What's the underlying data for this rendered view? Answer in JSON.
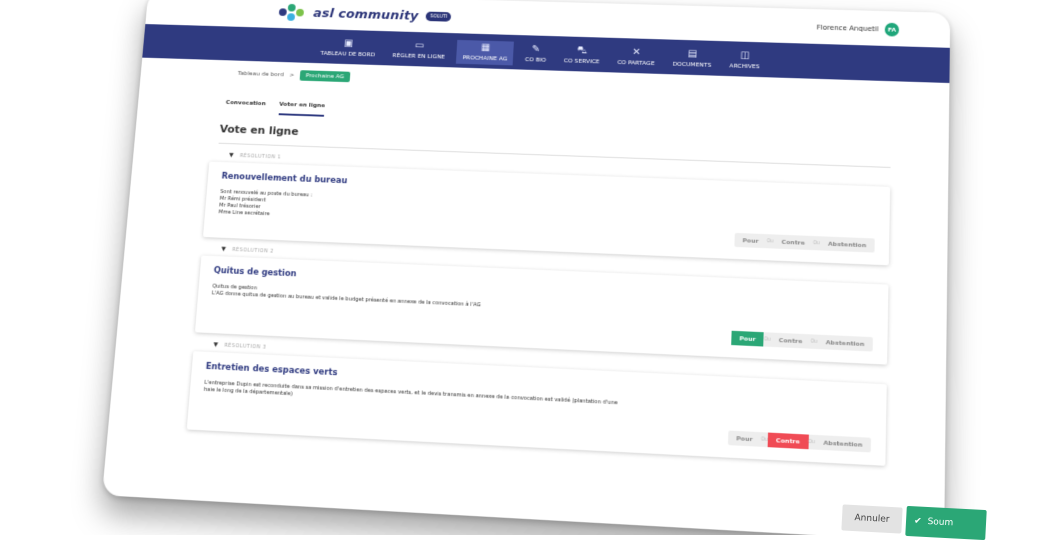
{
  "header": {
    "app_name": "asl community",
    "badge": "SOLUTI",
    "user_name": "Florence Anquetil",
    "user_initials": "FA"
  },
  "nav": [
    {
      "label": "TABLEAU DE BORD",
      "icon": "dashboard-icon"
    },
    {
      "label": "RÉGLER EN LIGNE",
      "icon": "credit-card-icon"
    },
    {
      "label": "PROCHAINE AG",
      "icon": "calendar-icon"
    },
    {
      "label": "CO BIO",
      "icon": "leaf-icon"
    },
    {
      "label": "CO SERVICE",
      "icon": "car-icon"
    },
    {
      "label": "CO PARTAGE",
      "icon": "tools-icon"
    },
    {
      "label": "DOCUMENTS",
      "icon": "folder-icon"
    },
    {
      "label": "ARCHIVES",
      "icon": "archive-icon"
    }
  ],
  "breadcrumb": {
    "home": "Tableau de bord",
    "sep": ">",
    "current": "Prochaine AG"
  },
  "tabs": [
    "Convocation",
    "Voter en ligne"
  ],
  "page_title": "Vote en ligne",
  "vote_labels": {
    "pour": "Pour",
    "ou": "Ou",
    "contre": "Contre",
    "abstention": "Abstention"
  },
  "resolutions": [
    {
      "header": "RÉSOLUTION 1",
      "title": "Renouvellement du bureau",
      "lines": [
        "Sont renouvelé au poste du bureau :",
        "Mr Rémi président",
        "Mr Paul trésorier",
        "Mme Line secrétaire"
      ],
      "selected": "none"
    },
    {
      "header": "RÉSOLUTION 2",
      "title": "Quitus de gestion",
      "lines": [
        "Quitus de gestion",
        "L'AG donne quitus de gestion au bureau et valide le budget présenté en annexe de la convocation à l'AG"
      ],
      "selected": "pour"
    },
    {
      "header": "RÉSOLUTION 3",
      "title": "Entretien des espaces verts",
      "lines": [
        "L'entreprise Dupin est reconduite dans sa mission d'entretien des espaces verts, et le devis transmis en annexe de la convocation est validé (plantation d'une haie le long de la départementale)"
      ],
      "selected": "contre"
    }
  ],
  "actions": {
    "cancel": "Annuler",
    "submit": "Soum"
  },
  "colors": {
    "nav_bg": "#2f3a80",
    "green": "#2ba776",
    "red": "#f04b55",
    "title_blue": "#2f3a80"
  }
}
